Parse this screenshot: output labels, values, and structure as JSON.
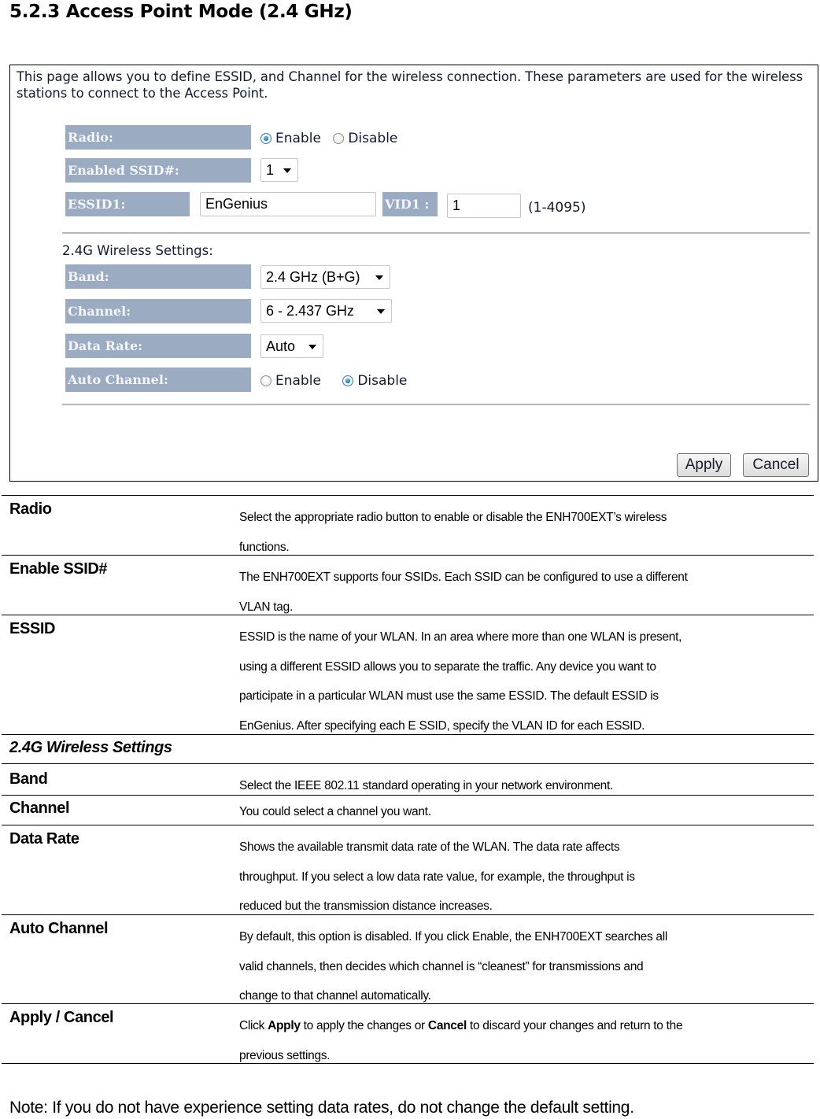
{
  "section": {
    "title": "5.2.3 Access Point Mode (2.4 GHz)"
  },
  "screenshot": {
    "intro": "This page allows you to define ESSID, and Channel for the wireless connection. These parameters are used for the wireless stations to connect to the Access Point.",
    "radio": {
      "label": "Radio:",
      "options": [
        "Enable",
        "Disable"
      ],
      "selected": "Enable"
    },
    "enabled_ssid": {
      "label": "Enabled SSID#:",
      "value": "1"
    },
    "essid1": {
      "label": "ESSID1:",
      "value": "EnGenius"
    },
    "vid1": {
      "label": "VID1 :",
      "value": "1",
      "range_hint": "(1-4095)"
    },
    "wireless_settings_heading": "2.4G Wireless Settings:",
    "band": {
      "label": "Band:",
      "value": "2.4 GHz (B+G)"
    },
    "channel": {
      "label": "Channel:",
      "value": "6 - 2.437 GHz"
    },
    "data_rate": {
      "label": "Data Rate:",
      "value": "Auto"
    },
    "auto_channel": {
      "label": "Auto Channel:",
      "options": [
        "Enable",
        "Disable"
      ],
      "selected": "Disable"
    },
    "buttons": {
      "apply": "Apply",
      "cancel": "Cancel"
    }
  },
  "descriptions": [
    {
      "term": "Radio",
      "lines": [
        "Select the appropriate radio button to enable or disable the ENH700EXT’s wireless",
        "functions."
      ]
    },
    {
      "term": "Enable SSID#",
      "lines": [
        "The ENH700EXT supports four SSIDs. Each SSID can be configured to use a different",
        "VLAN tag."
      ]
    },
    {
      "term": "ESSID",
      "lines": [
        "ESSID is the name of your WLAN. In an area where more than one WLAN is present,",
        "using a different ESSID allows you to separate the traffic. Any device you want to",
        "participate in a particular WLAN must use the same ESSID. The default ESSID is",
        "EnGenius. After specifying each E SSID, specify the VLAN ID for each ESSID."
      ]
    },
    {
      "term": "2.4G Wireless Settings",
      "lines": []
    },
    {
      "term": "Band",
      "lines": [
        "Select the IEEE 802.11 standard operating in your network environment."
      ]
    },
    {
      "term": "Channel",
      "lines": [
        "You could select a channel you want."
      ]
    },
    {
      "term": "Data Rate",
      "lines": [
        "Shows the available transmit data rate of the WLAN. The data rate affects",
        "throughput. If you select a low data rate value, for example, the throughput is",
        "reduced but the transmission distance increases."
      ]
    },
    {
      "term": "Auto Channel",
      "lines": [
        "By default, this option is disabled. If you click Enable, the ENH700EXT searches all",
        "valid channels, then decides which channel is “cleanest” for transmissions and",
        "change to that channel automatically."
      ]
    },
    {
      "term": "Apply / Cancel",
      "parts": {
        "click": "Click ",
        "apply": "Apply",
        "mid": " to apply the changes or ",
        "cancel": "Cancel",
        "rest": " to discard your changes and return to the"
      },
      "lines": [
        "previous settings."
      ]
    }
  ],
  "note": "Note: If you do not have experience setting data rates, do not change the default setting."
}
